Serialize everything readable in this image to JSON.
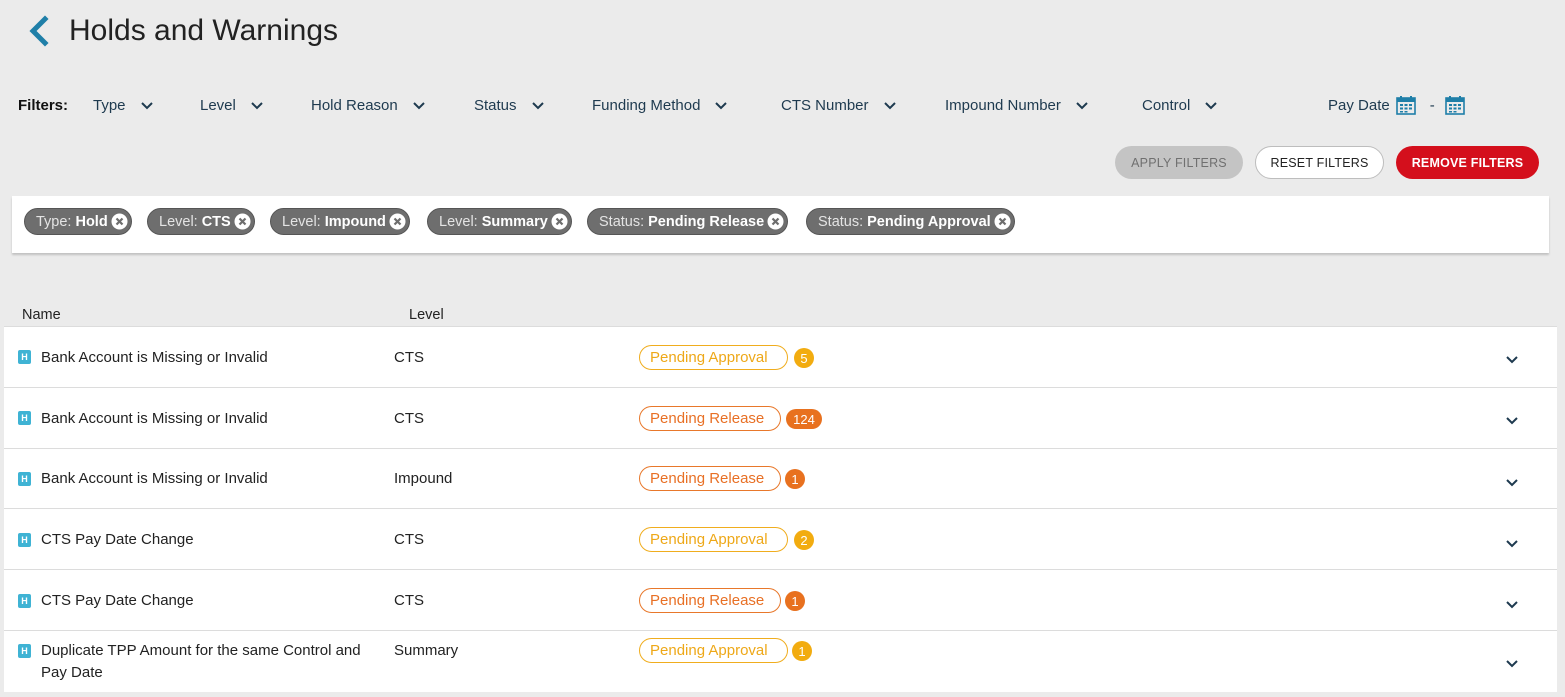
{
  "header": {
    "title": "Holds and Warnings",
    "back_icon": "chevron-left-icon"
  },
  "filters": {
    "label": "Filters:",
    "dropdowns": [
      {
        "label": "Type"
      },
      {
        "label": "Level"
      },
      {
        "label": "Hold Reason"
      },
      {
        "label": "Status"
      },
      {
        "label": "Funding Method"
      },
      {
        "label": "CTS Number"
      },
      {
        "label": "Impound Number"
      },
      {
        "label": "Control"
      }
    ],
    "pay_date": {
      "label": "Pay Date",
      "separator": "-"
    }
  },
  "buttons": {
    "apply": "APPLY FILTERS",
    "reset": "RESET FILTERS",
    "remove": "REMOVE FILTERS"
  },
  "active_filters": [
    {
      "key": "Type:",
      "value": "Hold"
    },
    {
      "key": "Level:",
      "value": "CTS"
    },
    {
      "key": "Level:",
      "value": "Impound"
    },
    {
      "key": "Level:",
      "value": "Summary"
    },
    {
      "key": "Status:",
      "value": "Pending Release"
    },
    {
      "key": "Status:",
      "value": "Pending Approval"
    }
  ],
  "table": {
    "columns": {
      "name": "Name",
      "level": "Level"
    },
    "rows": [
      {
        "badge": "H",
        "name": "Bank Account is Missing or Invalid",
        "level": "CTS",
        "status": "Pending Approval",
        "count": "5"
      },
      {
        "badge": "H",
        "name": "Bank Account is Missing or Invalid",
        "level": "CTS",
        "status": "Pending Release",
        "count": "124"
      },
      {
        "badge": "H",
        "name": "Bank Account is Missing or Invalid",
        "level": "Impound",
        "status": "Pending Release",
        "count": "1"
      },
      {
        "badge": "H",
        "name": "CTS Pay Date Change",
        "level": "CTS",
        "status": "Pending Approval",
        "count": "2"
      },
      {
        "badge": "H",
        "name": "CTS Pay Date Change",
        "level": "CTS",
        "status": "Pending Release",
        "count": "1"
      },
      {
        "badge": "H",
        "name": "Duplicate TPP Amount for the same Control and Pay Date",
        "level": "Summary",
        "status": "Pending Approval",
        "count": "1"
      }
    ]
  },
  "colors": {
    "accent": "#1f7fa8",
    "remove_button": "#d40f1c",
    "pending_approval": "#f2ac10",
    "pending_release": "#e8711f",
    "hold_badge": "#3fb3d4",
    "chip": "#6e6e6e"
  }
}
